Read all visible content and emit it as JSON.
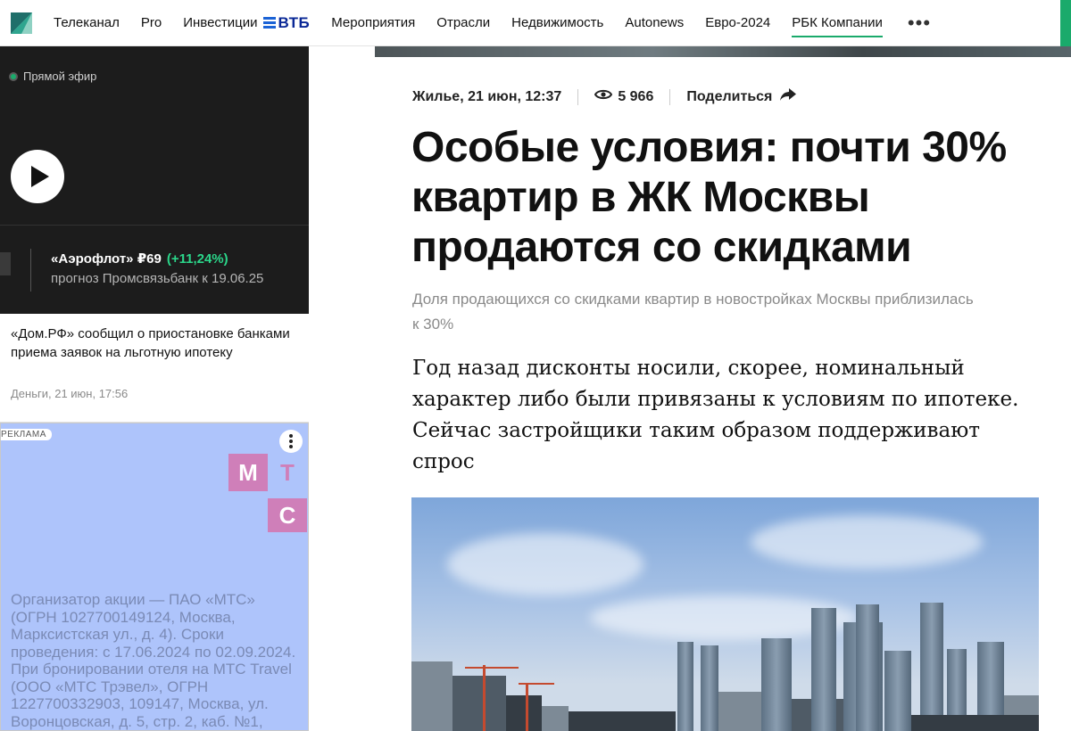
{
  "nav": {
    "items": [
      {
        "label": "Телеканал"
      },
      {
        "label": "Pro"
      },
      {
        "label": "Инвестиции"
      },
      {
        "label": "Мероприятия"
      },
      {
        "label": "Отрасли"
      },
      {
        "label": "Недвижимость"
      },
      {
        "label": "Autonews"
      },
      {
        "label": "Евро-2024"
      },
      {
        "label": "РБК Компании"
      }
    ],
    "partner_brand": "ВТБ",
    "active_item": "РБК Компании",
    "more_icon": "more-horizontal-icon",
    "accent_color": "#1aaa6b"
  },
  "sidebar": {
    "live": {
      "label": "Прямой эфир",
      "play_icon": "play-icon"
    },
    "ticker": {
      "name": "«Аэрофлот» ₽69",
      "change": "(+11,24%)",
      "subtitle": "прогноз Промсвязьбанк к 19.06.25",
      "change_color": "#2bd68a"
    },
    "news": {
      "title": "«Дом.РФ» сообщил о приостановке банками приема заявок на льготную ипотеку",
      "meta": "Деньги, 21 июн, 17:56"
    },
    "ad": {
      "badge": "РЕКЛАМА",
      "brand_letters": [
        "М",
        "Т",
        "С"
      ],
      "text": "Организатор акции — ПАО «МТС» (ОГРН 1027700149124, Москва, Марксистская ул., д. 4). Сроки проведения: с 17.06.2024 по 02.09.2024. При бронировании отеля на МТС Travel (ООО «МТС Трэвел», ОГРН 1227700332903, 109147, Москва, ул. Воронцовская, д. 5, стр. 2, каб. №1,",
      "background_color": "#aec4fb",
      "brand_color": "#cf7fb9"
    }
  },
  "article": {
    "category_date": "Жилье, 21 июн, 12:37",
    "views": "5 966",
    "share_label": "Поделиться",
    "title": "Особые условия: почти 30% квартир в ЖК Москвы продаются со скидками",
    "subtitle": "Доля продающихся со скидками квартир в новостройках Москвы приблизилась к 30%",
    "lead": "Год назад дисконты носили, скорее, номинальный характер либо были привязаны к условиям по ипотеке. Сейчас застройщики таким образом поддерживают спрос"
  }
}
